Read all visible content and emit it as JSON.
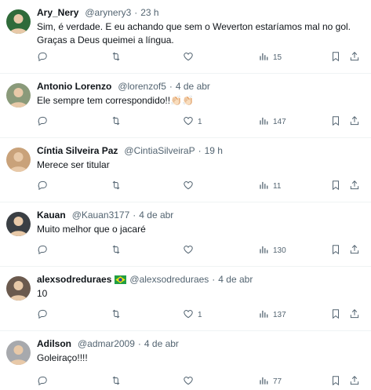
{
  "tweets": [
    {
      "name": "Ary_Nery",
      "handle": "@arynery3",
      "separator": "·",
      "time": "23 h",
      "text_lines": [
        "Sim, é verdade. E eu achando que sem o Weverton estaríamos mal no gol.",
        "Graças a Deus queimei a língua."
      ],
      "replies": "",
      "retweets": "",
      "likes": "",
      "views": "15",
      "avatar_color": "#2f6b3a"
    },
    {
      "name": "Antonio Lorenzo",
      "handle": "@lorenzof5",
      "separator": "·",
      "time": "4 de abr",
      "text_lines": [
        "Ele sempre tem correspondido!!👏🏻👏🏻"
      ],
      "replies": "",
      "retweets": "",
      "likes": "1",
      "views": "147",
      "avatar_color": "#8a9a7a"
    },
    {
      "name": "Cíntia Silveira Paz",
      "handle": "@CintiaSilveiraP",
      "separator": "·",
      "time": "19 h",
      "text_lines": [
        "Merece ser titular"
      ],
      "replies": "",
      "retweets": "",
      "likes": "",
      "views": "11",
      "avatar_color": "#c9a27a"
    },
    {
      "name": "Kauan",
      "handle": "@Kauan3177",
      "separator": "·",
      "time": "4 de abr",
      "text_lines": [
        "Muito melhor que o jacaré"
      ],
      "replies": "",
      "retweets": "",
      "likes": "",
      "views": "130",
      "avatar_color": "#3a3f44"
    },
    {
      "name": "alexsodreduraes",
      "handle": "@alexsodreduraes",
      "separator": "·",
      "time": "4 de abr",
      "text_lines": [
        "10"
      ],
      "replies": "",
      "retweets": "",
      "likes": "1",
      "views": "137",
      "avatar_color": "#6b5a4e",
      "has_flag": true
    },
    {
      "name": "Adilson",
      "handle": "@admar2009",
      "separator": "·",
      "time": "4 de abr",
      "text_lines": [
        "Goleiraço!!!!"
      ],
      "replies": "",
      "retweets": "",
      "likes": "",
      "views": "77",
      "avatar_color": "#a7a9ad"
    }
  ],
  "icons": {
    "reply": "reply-icon",
    "retweet": "retweet-icon",
    "like": "heart-icon",
    "views": "views-chart-icon",
    "bookmark": "bookmark-icon",
    "share": "share-icon"
  },
  "colors": {
    "text": "#0f1419",
    "secondary": "#536471",
    "divider": "#eff3f4"
  }
}
